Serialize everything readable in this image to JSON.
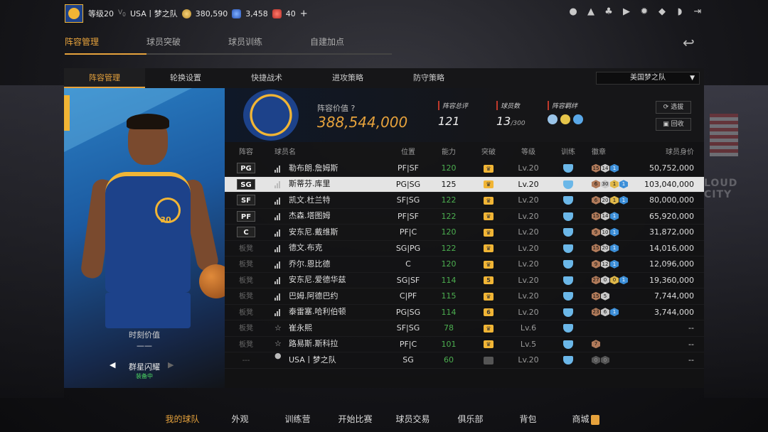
{
  "topbar": {
    "level": "等级20",
    "vip_icon": "vip-icon",
    "team": "USA丨梦之队",
    "coins": "380,590",
    "points": "3,458",
    "tickets": "40",
    "add": "+"
  },
  "main_tabs": [
    "阵容管理",
    "球员突破",
    "球员训练",
    "自建加点"
  ],
  "sub_tabs": [
    "阵容管理",
    "轮换设置",
    "快捷战术",
    "进攻策略",
    "防守策略"
  ],
  "team_select": "美国梦之队",
  "card": {
    "number": "30",
    "team_text": "GOLDEN STATE WARRIORS",
    "moment_label": "时刻价值",
    "moment_value": "——",
    "name": "群星闪耀",
    "status": "装备中"
  },
  "summary": {
    "lineup_value_label": "阵容价值",
    "lineup_value": "388,544,000",
    "total_rating_label": "阵容总评",
    "total_rating": "121",
    "player_count_label": "球员数",
    "player_count": "13",
    "player_max": "/300",
    "bond_label": "阵容羁绊",
    "btn_select": "选拔",
    "btn_recycle": "回收"
  },
  "table": {
    "headers": [
      "阵容",
      "球员名",
      "位置",
      "能力",
      "突破",
      "等级",
      "训练",
      "徽章",
      "球员身价"
    ],
    "rows": [
      {
        "pos": "PG",
        "name": "勒布朗.詹姆斯",
        "position": "PF|SF",
        "ovr": "120",
        "brk": "",
        "lvl": "Lv.20",
        "badges": [
          "15",
          "14",
          "1"
        ],
        "salary": "50,752,000"
      },
      {
        "pos": "SG",
        "name": "斯蒂芬.库里",
        "position": "PG|SG",
        "ovr": "125",
        "brk": "",
        "lvl": "Lv.20",
        "badges": [
          "6",
          "30",
          "1",
          "1"
        ],
        "salary": "103,040,000"
      },
      {
        "pos": "SF",
        "name": "凯文.杜兰特",
        "position": "SF|SG",
        "ovr": "122",
        "brk": "",
        "lvl": "Lv.20",
        "badges": [
          "6",
          "20",
          "1",
          "1"
        ],
        "salary": "80,000,000"
      },
      {
        "pos": "PF",
        "name": "杰森.塔图姆",
        "position": "PF|SF",
        "ovr": "122",
        "brk": "",
        "lvl": "Lv.20",
        "badges": [
          "15",
          "14",
          "1"
        ],
        "salary": "65,920,000"
      },
      {
        "pos": "C",
        "name": "安东尼.戴维斯",
        "position": "PF|C",
        "ovr": "120",
        "brk": "",
        "lvl": "Lv.20",
        "badges": [
          "9",
          "10",
          "1"
        ],
        "salary": "31,872,000"
      },
      {
        "pos": "板凳",
        "name": "德文.布克",
        "position": "SG|PG",
        "ovr": "122",
        "brk": "",
        "lvl": "Lv.20",
        "badges": [
          "15",
          "20",
          "1"
        ],
        "salary": "14,016,000"
      },
      {
        "pos": "板凳",
        "name": "乔尔.恩比德",
        "position": "C",
        "ovr": "120",
        "brk": "",
        "lvl": "Lv.20",
        "badges": [
          "9",
          "12",
          "1"
        ],
        "salary": "12,096,000"
      },
      {
        "pos": "板凳",
        "name": "安东尼.爱德华兹",
        "position": "SG|SF",
        "ovr": "114",
        "brk": "5",
        "lvl": "Lv.20",
        "badges": [
          "27",
          "0",
          "0",
          "1"
        ],
        "salary": "19,360,000"
      },
      {
        "pos": "板凳",
        "name": "巴姆.阿德巴约",
        "position": "C|PF",
        "ovr": "115",
        "brk": "",
        "lvl": "Lv.20",
        "badges": [
          "15",
          "5"
        ],
        "salary": "7,744,000"
      },
      {
        "pos": "板凳",
        "name": "泰雷塞.哈利伯顿",
        "position": "PG|SG",
        "ovr": "114",
        "brk": "6",
        "lvl": "Lv.20",
        "badges": [
          "23",
          "6",
          "1"
        ],
        "salary": "3,744,000"
      },
      {
        "pos": "板凳",
        "name": "崔永熙",
        "position": "SF|SG",
        "ovr": "78",
        "brk": "",
        "lvl": "Lv.6",
        "badges": [],
        "salary": "--"
      },
      {
        "pos": "板凳",
        "name": "路易斯.斯科拉",
        "position": "PF|C",
        "ovr": "101",
        "brk": "",
        "lvl": "Lv.5",
        "badges": [
          "7"
        ],
        "salary": "--"
      },
      {
        "pos": "---",
        "name": "USA丨梦之队",
        "position": "SG",
        "ovr": "60",
        "brk": "",
        "lvl": "Lv.20",
        "badges": [
          "0",
          "0"
        ],
        "salary": "--"
      }
    ]
  },
  "bottom_nav": [
    "我的球队",
    "外观",
    "训练营",
    "开始比赛",
    "球员交易",
    "俱乐部",
    "背包",
    "商城"
  ],
  "colors": {
    "accent": "#e6a23c",
    "green": "#4caf50",
    "selected_row": "#e4e4e4"
  }
}
